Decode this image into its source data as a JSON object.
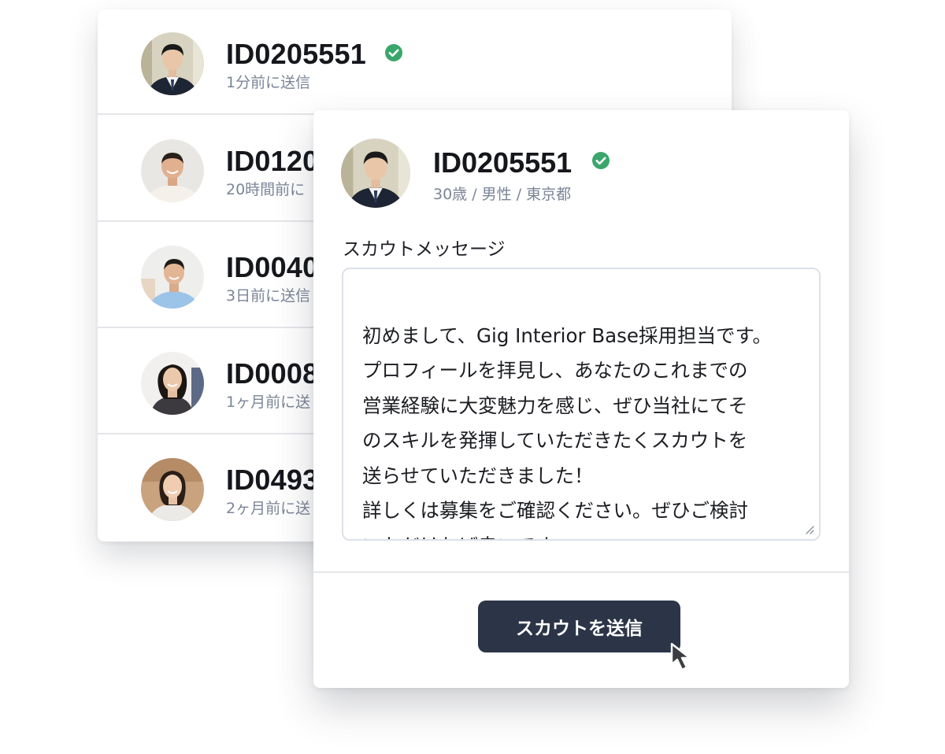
{
  "candidate_list": [
    {
      "id": "ID0205551",
      "sent": "1分前に送信",
      "verified": true
    },
    {
      "id": "ID0120",
      "sent": "20時間前に",
      "verified": false
    },
    {
      "id": "ID0040",
      "sent": "3日前に送信",
      "verified": false
    },
    {
      "id": "ID0008",
      "sent": "1ヶ月前に送",
      "verified": false
    },
    {
      "id": "ID0493",
      "sent": "2ヶ月前に送",
      "verified": false
    }
  ],
  "scout_modal": {
    "candidate_id": "ID0205551",
    "verified": true,
    "profile": "30歳 / 男性 / 東京都",
    "message_label": "スカウトメッセージ",
    "message": "初めまして、Gig Interior Base採用担当です。\nプロフィールを拝見し、あなたのこれまでの\n営業経験に大変魅力を感じ、ぜひ当社にてそ\nのスキルを発揮していただきたくスカウトを\n送らせていただきました！\n詳しくは募集をご確認ください。ぜひご検討\nいただければ幸いです。",
    "send_button": "スカウトを送信"
  },
  "icons": {
    "verified": "check-circle-icon",
    "cursor": "mouse-pointer-icon"
  },
  "colors": {
    "verified_green": "#3aa66b",
    "button_bg": "#2b3547",
    "muted_text": "#7b8597"
  }
}
